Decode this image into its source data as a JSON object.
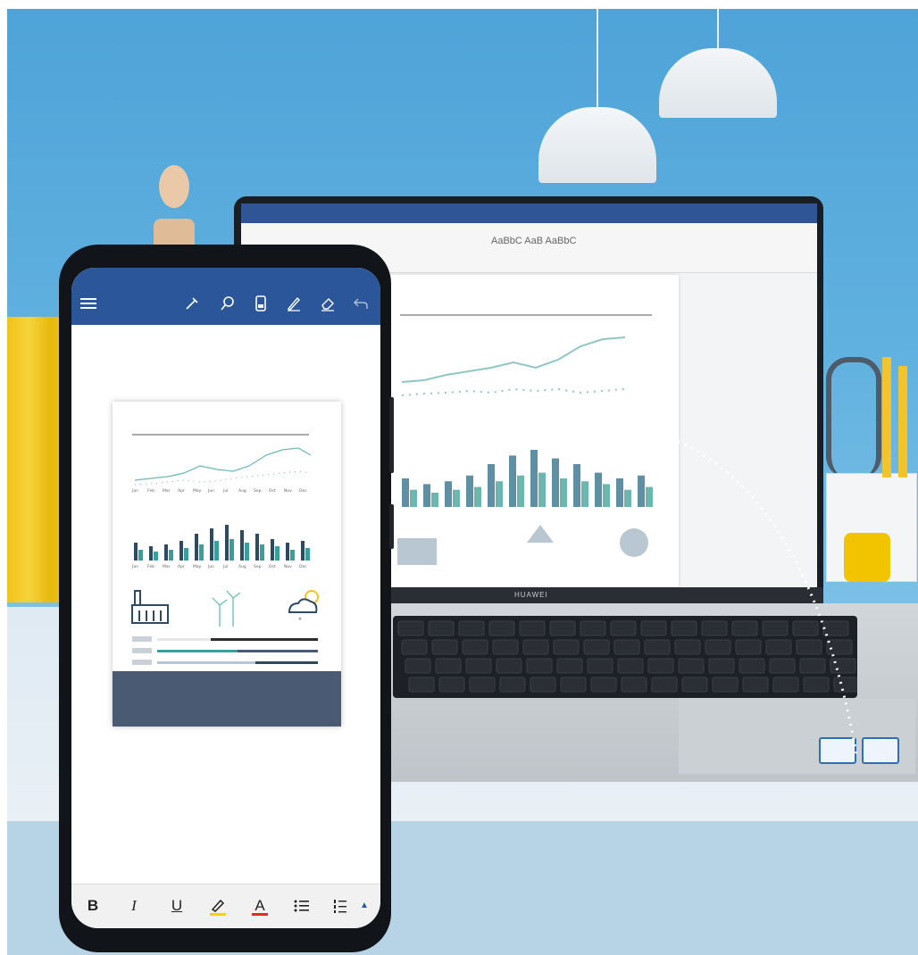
{
  "laptop": {
    "brand_text": "HUAWEI",
    "word_ribbon_text": "AaBbC AaB AaBbC"
  },
  "phone_app": {
    "toolbar": {
      "menu_icon": "hamburger-icon",
      "icons": [
        "pen-icon",
        "search-icon",
        "mobile-view-icon",
        "draw-icon",
        "eraser-icon",
        "undo-icon"
      ]
    },
    "format_bar": {
      "bold": "B",
      "italic": "I",
      "underline": "U",
      "highlight": "highlighter-icon",
      "font_color": "A",
      "bullets": "bullet-list-icon",
      "numbering": "numbered-list-icon",
      "more": "▲"
    },
    "colors": {
      "app_bar": "#2b579a",
      "highlight": "#f2d500",
      "font_color": "#e02b2b",
      "teal": "#3a9e9a",
      "navy": "#2e4a63"
    }
  },
  "doc_chart": {
    "months": [
      "Jan",
      "Feb",
      "Mar",
      "Apr",
      "May",
      "Jun",
      "Jul",
      "Aug",
      "Sep",
      "Oct",
      "Nov",
      "Dec"
    ],
    "bar_series": [
      [
        10,
        8,
        9,
        11,
        15,
        18,
        20,
        17,
        15,
        12,
        10,
        11
      ],
      [
        6,
        5,
        6,
        7,
        9,
        11,
        12,
        10,
        9,
        8,
        6,
        7
      ]
    ]
  }
}
